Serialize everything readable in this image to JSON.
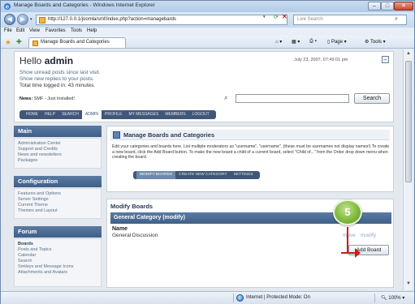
{
  "window": {
    "title": "Manage Boards and Categories - Windows Internet Explorer",
    "minimize": "–",
    "maximize": "□",
    "close": "✕"
  },
  "address_bar": {
    "url": "http://127.0.0.1/joomla/smf/index.php?action=managebards",
    "search_placeholder": "Live Search"
  },
  "menu": [
    "File",
    "Edit",
    "View",
    "Favorites",
    "Tools",
    "Help"
  ],
  "tab": {
    "label": "Manage Boards and Categories"
  },
  "commandbar": {
    "page": "Page",
    "tools": "Tools"
  },
  "header": {
    "greeting_prefix": "Hello ",
    "username": "admin",
    "datetime": "July 23, 2007, 07:49:01 pm",
    "unread": "Show unread posts since last visit.",
    "replies": "Show new replies to your posts.",
    "logged": "Total time logged in: 43 minutes.",
    "news_label": "News:",
    "news_text": " SMF - Just Installed!",
    "search_button": "Search"
  },
  "topnav": [
    "HOME",
    "HELP",
    "SEARCH",
    "ADMIN",
    "PROFILE",
    "MY MESSAGES",
    "MEMBERS",
    "LOGOUT"
  ],
  "topnav_active": "ADMIN",
  "sidebar": {
    "main": {
      "title": "Main",
      "items": [
        "Administration Center",
        "Support and Credits",
        "News and newsletters",
        "Packages"
      ]
    },
    "configuration": {
      "title": "Configuration",
      "items": [
        "Features and Options",
        "Server Settings",
        "Current Theme",
        "Themes and Layout"
      ]
    },
    "forum": {
      "title": "Forum",
      "items": [
        "Boards",
        "Posts and Topics",
        "Calendar",
        "Search",
        "Smileys and Message Icons",
        "Attachments and Avatars"
      ]
    }
  },
  "manage": {
    "title": "Manage Boards and Categories",
    "instructions": "Edit your categories and boards here. List multiple moderators as \"username\", \"username\". (these must be usernames not display names!) To create a new board, click the Add Board button. To make the new board a child of a current board, select \"Child of...\" from the Order drop down menu when creating the board.",
    "subtabs": [
      "MODIFY BOARDS",
      "CREATE NEW CATEGORY",
      "SETTINGS"
    ],
    "subtabs_active": "MODIFY BOARDS"
  },
  "modify": {
    "title": "Modify Boards",
    "category": "General Category (modify)",
    "name_header": "Name",
    "board": "General Discussion",
    "move": "move",
    "modify": "modify",
    "add_board": "Add Board"
  },
  "callout": {
    "step": "5"
  },
  "status": {
    "zone": "Internet | Protected Mode: On",
    "zoom": "100%"
  },
  "colors": {
    "nav_bar": "#41577a",
    "section_header": "#4d6d95",
    "step_green": "#7cb63a",
    "arrow_red": "#d31a1a"
  }
}
